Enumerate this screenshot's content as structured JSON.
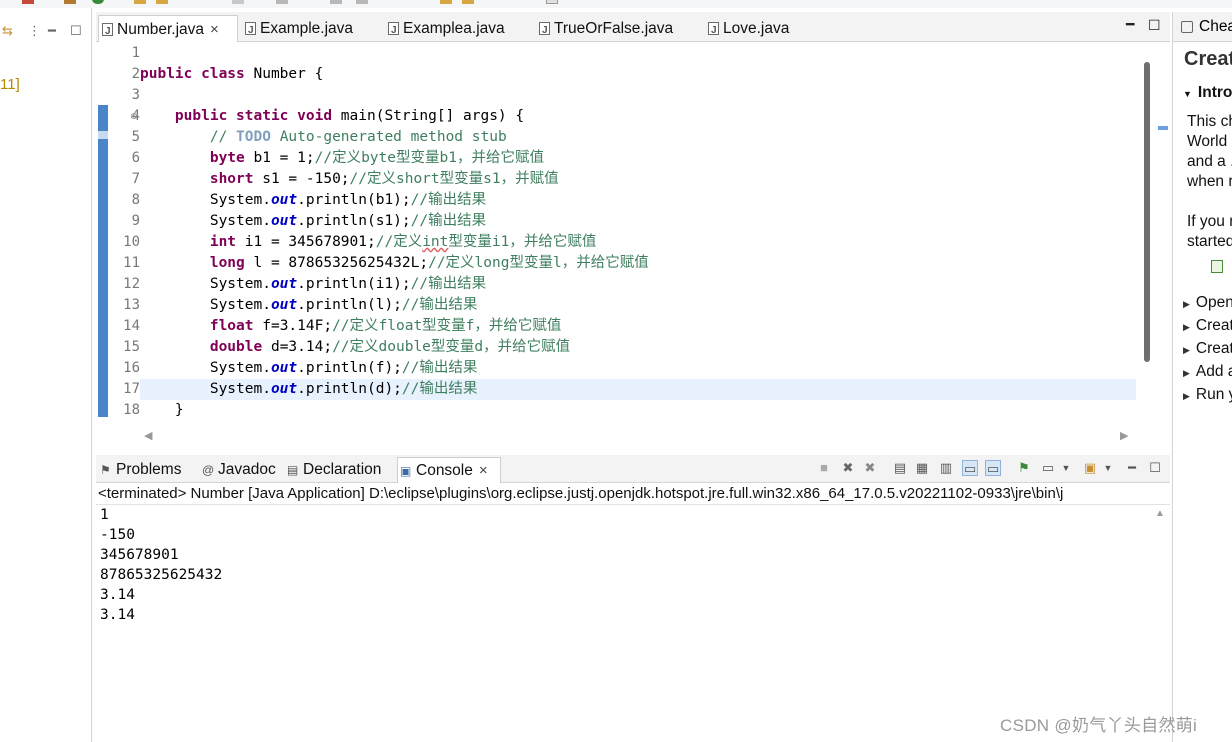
{
  "editor": {
    "tabs": [
      {
        "label": "Number.java",
        "active": true
      },
      {
        "label": "Example.java",
        "active": false
      },
      {
        "label": "Examplea.java",
        "active": false
      },
      {
        "label": "TrueOrFalse.java",
        "active": false
      },
      {
        "label": "Love.java",
        "active": false
      }
    ],
    "line_numbers": [
      "1",
      "2",
      "3",
      "4",
      "5",
      "6",
      "7",
      "8",
      "9",
      "10",
      "11",
      "12",
      "13",
      "14",
      "15",
      "16",
      "17",
      "18"
    ],
    "current_line": "17"
  },
  "left_panel": {
    "fragment": "11]"
  },
  "code_lines": [
    {
      "n": "1"
    },
    {
      "n": "2",
      "kw1": "public class",
      "rest": " Number {"
    },
    {
      "n": "3"
    },
    {
      "n": "4",
      "kw1": "public static void",
      "rest": " main(String[] args) {"
    },
    {
      "n": "5",
      "comment_pre": "// ",
      "todo": "TODO",
      "comment": " Auto-generated method stub"
    },
    {
      "n": "6",
      "kw1": "byte",
      "rest": " b1 = 1;",
      "comment": "//定义byte型变量b1，并给它赋值"
    },
    {
      "n": "7",
      "kw1": "short",
      "rest": " s1 = -150;",
      "comment": "//定义short型变量s1，并赋值"
    },
    {
      "n": "8",
      "pre": "System.",
      "field": "out",
      "rest": ".println(b1);",
      "comment": "//输出结果"
    },
    {
      "n": "9",
      "pre": "System.",
      "field": "out",
      "rest": ".println(s1);",
      "comment": "//输出结果"
    },
    {
      "n": "10",
      "kw1": "int",
      "rest": " i1 = 345678901;",
      "comment_pre": "//定义",
      "squig": "int",
      "comment": "型变量i1，并给它赋值"
    },
    {
      "n": "11",
      "kw1": "long",
      "rest": " l = 87865325625432L;",
      "comment": "//定义long型变量l，并给它赋值"
    },
    {
      "n": "12",
      "pre": "System.",
      "field": "out",
      "rest": ".println(i1);",
      "comment": "//输出结果"
    },
    {
      "n": "13",
      "pre": "System.",
      "field": "out",
      "rest": ".println(l);",
      "comment": "//输出结果"
    },
    {
      "n": "14",
      "kw1": "float",
      "rest": " f=3.14F;",
      "comment": "//定义float型变量f，并给它赋值"
    },
    {
      "n": "15",
      "kw1": "double",
      "rest": " d=3.14;",
      "comment": "//定义double型变量d，并给它赋值"
    },
    {
      "n": "16",
      "pre": "System.",
      "field": "out",
      "rest": ".println(f);",
      "comment": "//输出结果"
    },
    {
      "n": "17",
      "pre": "System.",
      "field": "out",
      "rest": ".println(d);",
      "comment": "//输出结果"
    },
    {
      "n": "18",
      "rest": "}"
    }
  ],
  "bottom": {
    "tabs": [
      {
        "label": "Problems",
        "icon": "problems-icon",
        "active": false
      },
      {
        "label": "Javadoc",
        "icon": "javadoc-icon",
        "active": false
      },
      {
        "label": "Declaration",
        "icon": "declaration-icon",
        "active": false
      },
      {
        "label": "Console",
        "icon": "console-icon",
        "active": true
      }
    ],
    "console_description": "<terminated> Number [Java Application] D:\\eclipse\\plugins\\org.eclipse.justj.openjdk.hotspot.jre.full.win32.x86_64_17.0.5.v20221102-0933\\jre\\bin\\j",
    "console_output": [
      "1",
      "-150",
      "345678901",
      "87865325625432",
      "3.14",
      "3.14"
    ]
  },
  "right_panel": {
    "tab_label": "Chea",
    "title": "Creat",
    "section": "Intro",
    "paragraph1": [
      "This ch",
      "World",
      "and a .",
      "when r"
    ],
    "paragraph2": [
      "If you r",
      "started"
    ],
    "items": [
      "Open",
      "Creat",
      "Creat",
      "Add a",
      "Run y"
    ]
  },
  "watermark": "CSDN @奶气丫头自然萌i",
  "colors": {
    "keyword": "#7f0055",
    "comment": "#3f7f5f",
    "field": "#0000c0",
    "current_line": "#e8f2fe",
    "ruler_mark": "#4a84c9"
  }
}
